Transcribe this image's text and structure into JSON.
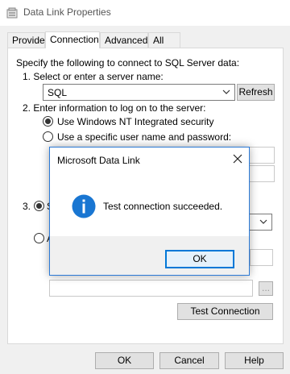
{
  "window": {
    "title": "Data Link Properties"
  },
  "tabs": [
    "Provider",
    "Connection",
    "Advanced",
    "All"
  ],
  "connection": {
    "intro": "Specify the following to connect to SQL Server data:",
    "step1_label": "1. Select or enter a server name:",
    "server_value": "SQL",
    "refresh_label": "Refresh",
    "step2_label": "2. Enter information to log on to the server:",
    "use_nt_label": "Use Windows NT Integrated security",
    "use_specific_label": "Use a specific user name and password:",
    "step3_number": "3.",
    "step3_partial": "S",
    "attach_partial": "A",
    "browse_label": "...",
    "test_connection_label": "Test Connection"
  },
  "footer": {
    "ok": "OK",
    "cancel": "Cancel",
    "help": "Help"
  },
  "dialog": {
    "title": "Microsoft Data Link",
    "message": "Test connection succeeded.",
    "ok": "OK"
  },
  "colors": {
    "accent": "#0078d7",
    "info_icon": "#1976d2"
  }
}
